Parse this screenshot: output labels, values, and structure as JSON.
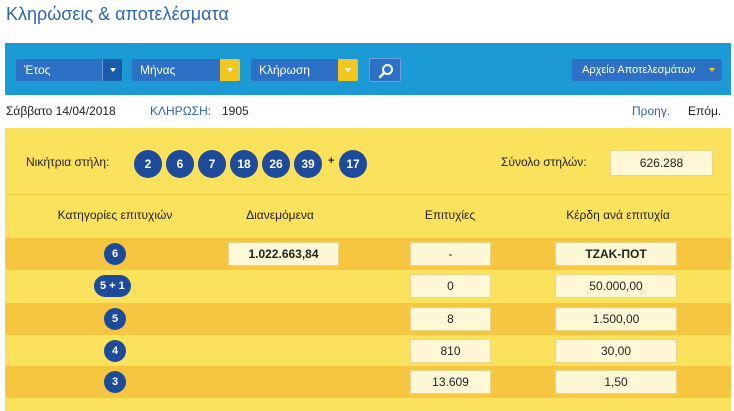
{
  "page": {
    "title": "Κληρώσεις & αποτελέσματα"
  },
  "filters": {
    "year": "Έτος",
    "month": "Μήνας",
    "draw": "Κλήρωση",
    "search_icon": "search-icon",
    "archive": "Αρχείο Αποτελεσμάτων"
  },
  "info": {
    "date": "Σάββατο 14/04/2018",
    "draw_label": "ΚΛΗΡΩΣΗ:",
    "draw_number": "1905",
    "prev": "Προηγ.",
    "next": "Επόμ."
  },
  "result": {
    "winning_label": "Νικήτρια στήλη:",
    "numbers": [
      "2",
      "6",
      "7",
      "18",
      "26",
      "39"
    ],
    "plus": "+",
    "joker": "17",
    "total_label": "Σύνολο στηλών:",
    "total_value": "626.288"
  },
  "table": {
    "headers": [
      "Κατηγορίες επιτυχιών",
      "Διανεμόμενα",
      "Επιτυχίες",
      "Κέρδη ανά επιτυχία"
    ],
    "rows": [
      {
        "category": "6",
        "distributed": "1.022.663,84",
        "winners": "-",
        "prize": "ΤΖΑΚ-ΠΟΤ"
      },
      {
        "category": "5 + 1",
        "distributed": "",
        "winners": "0",
        "prize": "50.000,00"
      },
      {
        "category": "5",
        "distributed": "",
        "winners": "8",
        "prize": "1.500,00"
      },
      {
        "category": "4",
        "distributed": "",
        "winners": "810",
        "prize": "30,00"
      },
      {
        "category": "3",
        "distributed": "",
        "winners": "13.609",
        "prize": "1,50"
      }
    ]
  },
  "colors": {
    "accent_blue": "#1c9ad6",
    "ball_blue": "#1e4a9a",
    "panel_yellow": "#fbe25c",
    "stripe": "#f6c640",
    "link_blue": "#2a66b8"
  }
}
